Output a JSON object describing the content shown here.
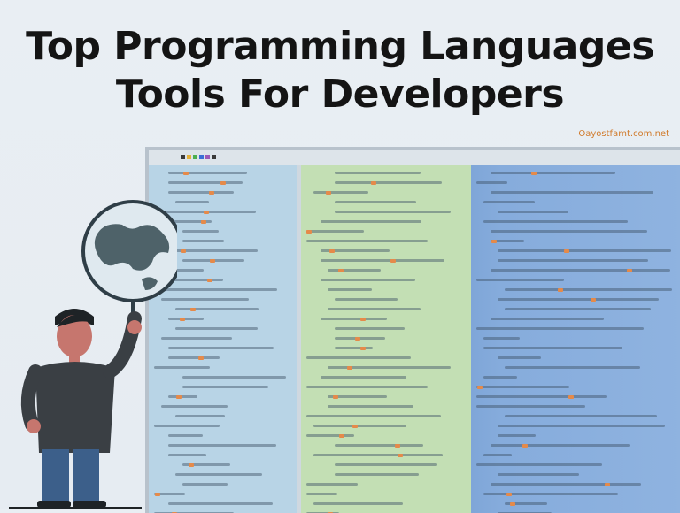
{
  "heading": {
    "line1": "Top Programming Languages",
    "line2": "Tools For Developers"
  },
  "watermark": "Oayostfamt.com.net",
  "colors": {
    "panel_left": "#b8d4e6",
    "panel_middle": "#c3dfb4",
    "panel_right": "#86acdc",
    "highlight": "#e58a4a"
  },
  "illustration": {
    "subject": "developer-holding-globe",
    "icons": [
      "globe-icon",
      "person-icon",
      "code-editor-icon"
    ]
  }
}
